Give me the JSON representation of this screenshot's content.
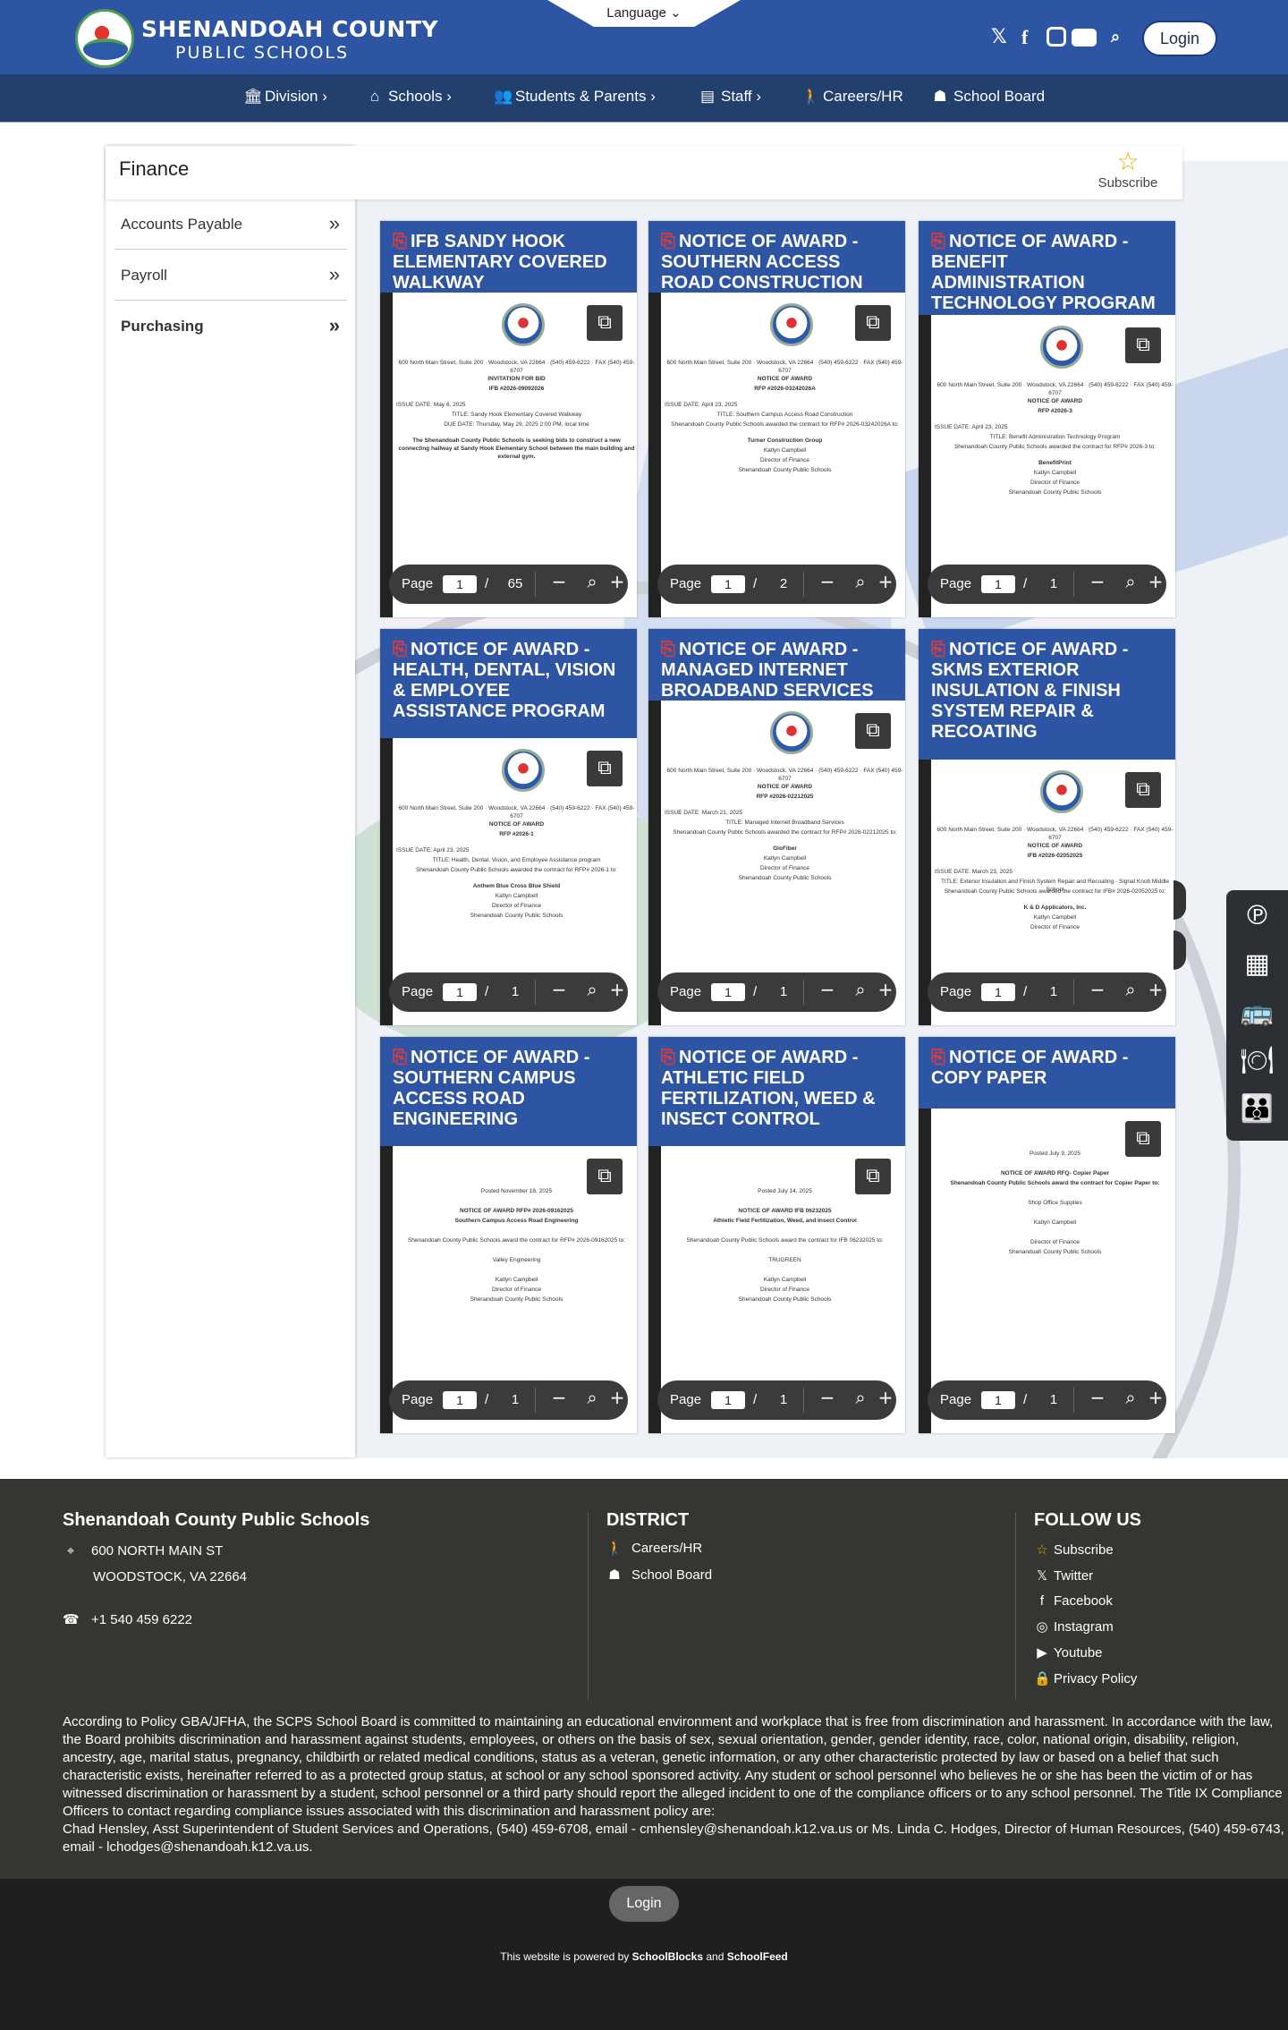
{
  "header": {
    "brand_line1": "SHENANDOAH COUNTY",
    "brand_line2": "PUBLIC SCHOOLS",
    "language": "Language",
    "login": "Login",
    "social": [
      "x-icon",
      "facebook-icon",
      "instagram-icon",
      "youtube-icon",
      "search-icon"
    ]
  },
  "nav": [
    {
      "label": "Division",
      "icon": "landmark-icon"
    },
    {
      "label": "Schools",
      "icon": "home-icon"
    },
    {
      "label": "Students & Parents",
      "icon": "users-icon"
    },
    {
      "label": "Staff",
      "icon": "chalkboard-teacher-icon"
    },
    {
      "label": "Careers/HR",
      "icon": "person-icon"
    },
    {
      "label": "School Board",
      "icon": "group-icon"
    }
  ],
  "page": {
    "title": "Finance",
    "subscribe": "Subscribe"
  },
  "sidebar": [
    {
      "label": "Accounts Payable",
      "active": false
    },
    {
      "label": "Payroll",
      "active": false
    },
    {
      "label": "Purchasing",
      "active": true
    }
  ],
  "pager_label": "Page",
  "documents": [
    {
      "title": "IFB SANDY HOOK ELEMENTARY COVERED WALKWAY",
      "page": "1",
      "total": "65"
    },
    {
      "title": "NOTICE OF AWARD - SOUTHERN ACCESS ROAD CONSTRUCTION",
      "page": "1",
      "total": "2"
    },
    {
      "title": "NOTICE OF AWARD - BENEFIT ADMINISTRATION TECHNOLOGY PROGRAM",
      "page": "1",
      "total": "1"
    },
    {
      "title": "NOTICE OF AWARD - HEALTH, DENTAL, VISION & EMPLOYEE ASSISTANCE PROGRAM",
      "page": "1",
      "total": "1"
    },
    {
      "title": "NOTICE OF AWARD - MANAGED INTERNET BROADBAND SERVICES",
      "page": "1",
      "total": "1"
    },
    {
      "title": "NOTICE OF AWARD - SKMS EXTERIOR INSULATION & FINISH SYSTEM REPAIR & RECOATING",
      "page": "1",
      "total": "1"
    },
    {
      "title": "NOTICE OF AWARD - SOUTHERN CAMPUS ACCESS ROAD ENGINEERING",
      "page": "1",
      "total": "1"
    },
    {
      "title": "NOTICE OF AWARD - ATHLETIC FIELD FERTILIZATION, WEED & INSECT CONTROL",
      "page": "1",
      "total": "1"
    },
    {
      "title": "NOTICE OF AWARD - COPY PAPER",
      "page": "1",
      "total": "1"
    }
  ],
  "previews": [
    {
      "lines": [
        "600 North Main Street, Suite 200 · Woodstock, VA 22664 · (540) 459-6222 · FAX (540) 459-6707",
        "INVITATION FOR BID",
        "IFB #2026-09092026",
        "ISSUE DATE: May 6, 2025",
        "TITLE: Sandy Hook Elementary Covered Walkway",
        "DUE DATE: Thursday, May 29, 2025 2:00 PM, local time",
        "The Shenandoah County Public Schools is seeking bids to construct a new connecting hallway at Sandy Hook Elementary School between the main building and external gym."
      ]
    },
    {
      "lines": [
        "600 North Main Street, Suite 200 · Woodstock, VA 22664 · (540) 459-6222 · FAX (540) 459-6707",
        "NOTICE OF AWARD",
        "RFP #2026-03242026A",
        "ISSUE DATE: April 23, 2025",
        "TITLE: Southern Campus Access Road Construction",
        "Shenandoah County Public Schools awarded the contract for RFP# 2026-03242026A to:",
        "Turner Construction Group",
        "Katlyn Campbell",
        "Director of Finance",
        "Shenandoah County Public Schools"
      ]
    },
    {
      "lines": [
        "600 North Main Street, Suite 200 · Woodstock, VA 22664 · (540) 459-6222 · FAX (540) 459-6707",
        "NOTICE OF AWARD",
        "RFP #2026-3",
        "ISSUE DATE: April 23, 2025",
        "TITLE: Benefit Administration Technology Program",
        "Shenandoah County Public Schools awarded the contract for RFP# 2026-3 to:",
        "BenefitPrint",
        "Katlyn Campbell",
        "Director of Finance",
        "Shenandoah County Public Schools"
      ]
    },
    {
      "lines": [
        "600 North Main Street, Suite 200 · Woodstock, VA 22664 · (540) 459-6222 · FAX (540) 459-6707",
        "NOTICE OF AWARD",
        "RFP #2026-1",
        "ISSUE DATE: April 23, 2025",
        "TITLE: Health, Dental, Vision, and Employee Assistance program",
        "Shenandoah County Public Schools awarded the contract for RFP# 2026-1 to:",
        "Anthem Blue Cross Blue Shield",
        "Katlyn Campbell",
        "Director of Finance",
        "Shenandoah County Public Schools"
      ]
    },
    {
      "lines": [
        "600 North Main Street, Suite 200 · Woodstock, VA 22664 · (540) 459-6222 · FAX (540) 459-6707",
        "NOTICE OF AWARD",
        "RFP #2026-02212025",
        "ISSUE DATE: March 21, 2025",
        "TITLE: Managed Internet Broadband Services",
        "Shenandoah County Public Schools awarded the contract for RFP# 2026-02212025 to:",
        "GloFiber",
        "Katlyn Campbell",
        "Director of Finance",
        "Shenandoah County Public Schools"
      ]
    },
    {
      "lines": [
        "600 North Main Street, Suite 200 · Woodstock, VA 22664 · (540) 459-6222 · FAX (540) 459-6707",
        "NOTICE OF AWARD",
        "IFB #2026-02052025",
        "ISSUE DATE: March 23, 2025",
        "TITLE: Exterior Insulation and Finish System Repair and Recoating - Signal Knob Middle School",
        "Shenandoah County Public Schools awarded the contract for IFB# 2026-02052025 to:",
        "K & D Applicators, Inc.",
        "Katlyn Campbell",
        "Director of Finance"
      ]
    },
    {
      "lines": [
        "Posted November 18, 2025",
        "NOTICE OF AWARD RFP# 2026-09162025",
        "Southern Campus Access Road Engineering",
        "Shenandoah County Public Schools award the contract for RFP# 2026-09162025 to:",
        "Valley Engineering",
        "Katlyn Campbell",
        "Director of Finance",
        "Shenandoah County Public Schools"
      ]
    },
    {
      "lines": [
        "Posted July 14, 2025",
        "NOTICE OF AWARD IFB 06232025",
        "Athletic Field Fertilization, Weed, and Insect Control",
        "Shenandoah County Public Schools award the contract for IFB 06232025 to:",
        "TRUGREEN",
        "Katlyn Campbell",
        "Director of Finance",
        "Shenandoah County Public Schools"
      ]
    },
    {
      "lines": [
        "Posted July 9, 2025",
        "NOTICE OF AWARD RFQ- Copier Paper",
        "Shenandoah County Public Schools award the contract for Copier Paper to:",
        "Shop Office Supplies",
        "Katlyn Campbell",
        "Director of Finance",
        "Shenandoah County Public Schools"
      ]
    }
  ],
  "footer": {
    "org": "Shenandoah County Public Schools",
    "address1": "600 NORTH MAIN ST",
    "address2": "WOODSTOCK, VA 22664",
    "phone": "+1 540 459 6222",
    "district_heading": "DISTRICT",
    "district_links": [
      "Careers/HR",
      "School Board"
    ],
    "follow_heading": "FOLLOW US",
    "follow_links": [
      {
        "label": "Subscribe",
        "icon": "star-icon"
      },
      {
        "label": "Twitter",
        "icon": "x-icon"
      },
      {
        "label": "Facebook",
        "icon": "facebook-icon"
      },
      {
        "label": "Instagram",
        "icon": "instagram-icon"
      },
      {
        "label": "Youtube",
        "icon": "youtube-icon"
      },
      {
        "label": "Privacy Policy",
        "icon": "lock-icon"
      }
    ],
    "policy": "According to Policy GBA/JFHA, the SCPS School Board is committed to maintaining an educational environment and workplace that is free from discrimination and harassment. In accordance with the law, the Board prohibits discrimination and harassment against students, employees, or others on the basis of sex, sexual orientation, gender, gender identity, race, color, national origin, disability, religion, ancestry, age, marital status, pregnancy, childbirth or related medical conditions, status as a veteran, genetic information, or any other characteristic protected by law or based on a belief that such characteristic exists, hereinafter referred to as a protected group status, at school or any school sponsored activity. Any student or school personnel who believes he or she has been the victim of or has witnessed discrimination or harassment by a student, school personnel or a third party should report the alleged incident to one of the compliance officers or to any school personnel. The Title IX Compliance Officers to contact regarding compliance issues associated with this discrimination and harassment policy are:",
    "contacts": "Chad Hensley, Asst Superintendent of Student Services and Operations, (540) 459-6708, email - cmhensley@shenandoah.k12.va.us or Ms. Linda C. Hodges, Director of Human Resources, (540) 459-6743, email - lchodges@shenandoah.k12.va.us.",
    "login": "Login",
    "powered_prefix": "This website is powered by",
    "powered_a": "SchoolBlocks",
    "powered_and": "and",
    "powered_b": "SchoolFeed"
  },
  "quicklinks": [
    "powerschool-icon",
    "calendar-icon",
    "bus-icon",
    "dining-icon",
    "family-icon"
  ]
}
